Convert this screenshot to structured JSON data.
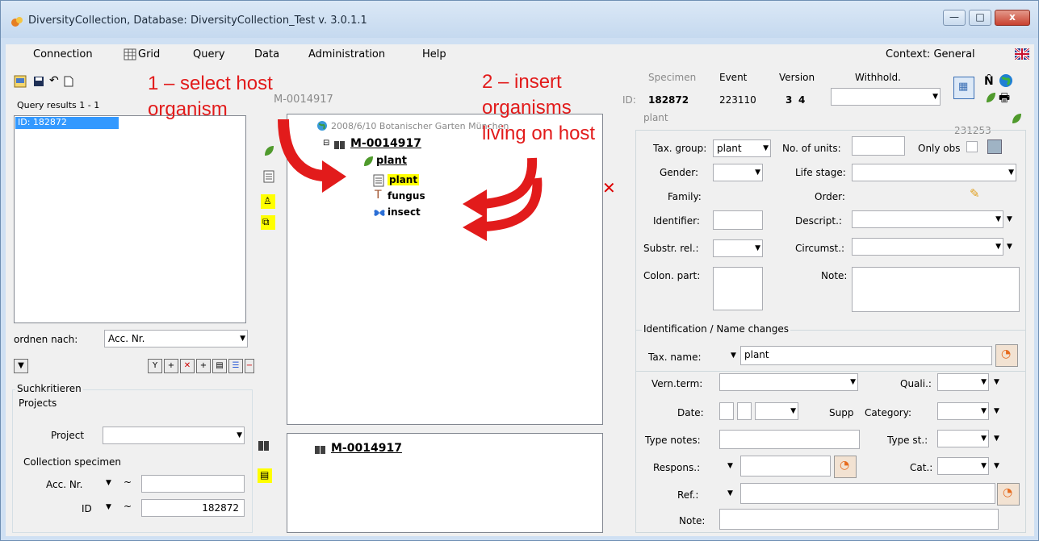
{
  "window": {
    "title": "DiversityCollection,  Database: DiversityCollection_Test   v. 3.0.1.1",
    "min": "—",
    "max": "□",
    "close": "x"
  },
  "menu": {
    "items": [
      "Connection",
      "Grid",
      "Query",
      "Data",
      "Administration",
      "Help"
    ],
    "context": "Context: General"
  },
  "left": {
    "query_results": "Query results  1 - 1",
    "result_item": "ID: 182872",
    "order_label": "ordnen nach:",
    "order_value": "Acc. Nr.",
    "suchkriterien": "Suchkritieren",
    "projects": "Projects",
    "project_label": "Project",
    "collection_specimen": "Collection specimen",
    "accnr_label": "Acc. Nr.",
    "id_label": "ID",
    "tilde": "~",
    "id_value": "182872"
  },
  "middle": {
    "header_code": "M-0014917",
    "event_text": "2008/6/10 Botanischer Garten München",
    "tree_root": "M-0014917",
    "tree_plant": "plant",
    "tree_plant_sub": "plant",
    "tree_fungus": "fungus",
    "tree_insect": "insect",
    "plant_header": "plant",
    "bottom_tree_root": "M-0014917"
  },
  "annotations": {
    "step1_line1": "1 – select host",
    "step1_line2": "organism",
    "step2_line1": "2 – insert",
    "step2_line2": "organisms",
    "step2_line3": "living on host"
  },
  "right": {
    "specimen_label": "Specimen",
    "event_label": "Event",
    "version_label": "Version",
    "withhold_label": "Withhold.",
    "id_label": "ID:",
    "specimen_id": "182872",
    "event_id": "223110",
    "version_a": "3",
    "version_b": "4",
    "unit_name": "plant",
    "unit_id": "231253",
    "taxgroup_label": "Tax. group:",
    "taxgroup_value": "plant",
    "no_units_label": "No. of units:",
    "only_obs_label": "Only obs",
    "gender_label": "Gender:",
    "lifestage_label": "Life stage:",
    "family_label": "Family:",
    "order_label": "Order:",
    "identifier_label": "Identifier:",
    "descript_label": "Descript.:",
    "substr_label": "Substr. rel.:",
    "circumst_label": "Circumst.:",
    "colon_label": "Colon. part:",
    "note_label": "Note:",
    "ident_group": "Identification / Name changes",
    "taxname_label": "Tax. name:",
    "taxname_value": "plant",
    "vernterm_label": "Vern.term:",
    "quali_label": "Quali.:",
    "date_label": "Date:",
    "supp_label": "Supp",
    "category_label": "Category:",
    "typenotes_label": "Type notes:",
    "typest_label": "Type st.:",
    "respons_label": "Respons.:",
    "cat_label": "Cat.:",
    "ref_label": "Ref.:",
    "note2_label": "Note:"
  },
  "colors": {
    "annotation_red": "#e21b1b",
    "selection_blue": "#3399ff",
    "highlight_yellow": "#ffff00"
  }
}
